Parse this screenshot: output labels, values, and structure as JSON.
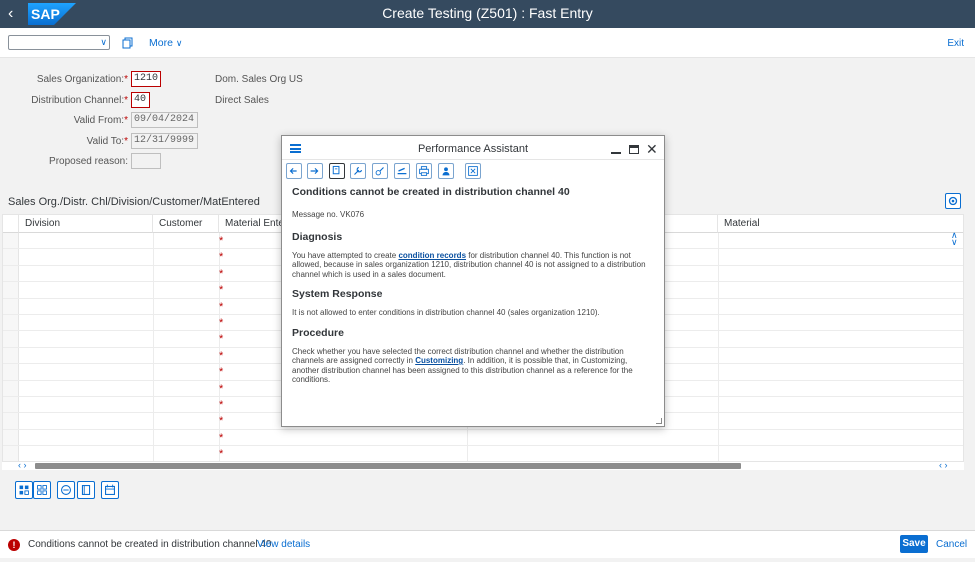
{
  "shell": {
    "logo_text": "SAP",
    "title": "Create Testing (Z501) : Fast Entry"
  },
  "toolbar": {
    "select_value": "",
    "more_label": "More",
    "exit_label": "Exit"
  },
  "form": {
    "sales_org": {
      "label": "Sales Organization:",
      "value": "1210",
      "description": "Dom. Sales Org US"
    },
    "dist_channel": {
      "label": "Distribution Channel:",
      "value": "40",
      "description": "Direct Sales"
    },
    "valid_from": {
      "label": "Valid From:",
      "value": "09/04/2024"
    },
    "valid_to": {
      "label": "Valid To:",
      "value": "12/31/9999"
    },
    "proposed_reason": {
      "label": "Proposed reason:",
      "value": ""
    },
    "required_marker": "*"
  },
  "table": {
    "title": "Sales Org./Distr. Chl/Division/Customer/MatEntered",
    "columns": [
      "Division",
      "Customer",
      "Material Entered",
      "Material"
    ],
    "row_count": 14,
    "required_marker": "*"
  },
  "dialog": {
    "title": "Performance Assistant",
    "heading": "Conditions cannot be created in distribution channel 40",
    "message_no": "Message no. VK076",
    "diagnosis_title": "Diagnosis",
    "diagnosis_pre": "You have attempted to create ",
    "diagnosis_link": "condition records",
    "diagnosis_post": " for distribution channel 40. This function is not allowed, because in sales organization 1210, distribution channel 40 is not assigned to a distribution channel which is used in a sales document.",
    "system_response_title": "System Response",
    "system_response_text": "It is not allowed to enter conditions in distribution channel 40 (sales organization 1210).",
    "procedure_title": "Procedure",
    "procedure_pre": "Check whether you have selected the correct distribution channel and whether the distribution channels are assigned correctly in ",
    "procedure_link": "Customizing",
    "procedure_post": ". In addition, it is possible that, in Customizing, another distribution channel has been assigned to this distribution channel as a reference for the conditions."
  },
  "footer": {
    "error_message": "Conditions cannot be created in distribution channel 40",
    "view_details": "View details",
    "save_label": "Save",
    "cancel_label": "Cancel"
  },
  "colors": {
    "shell_bg": "#354a5f",
    "accent": "#0a6ed1",
    "error": "#bb0000"
  }
}
